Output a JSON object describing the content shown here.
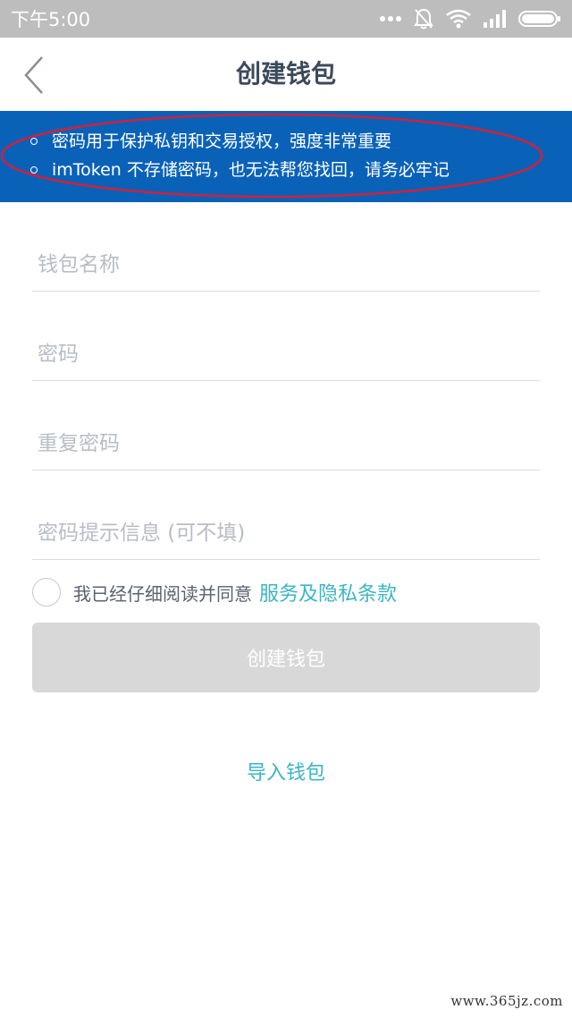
{
  "status_bar": {
    "time": "下午5:00",
    "icons": [
      "more-dots-icon",
      "bell-off-icon",
      "wifi-icon",
      "signal-icon",
      "battery-icon"
    ]
  },
  "nav": {
    "title": "创建钱包",
    "back_icon": "chevron-left-icon"
  },
  "notice": {
    "items": [
      "密码用于保护私钥和交易授权，强度非常重要",
      "imToken 不存储密码，也无法帮您找回，请务必牢记"
    ],
    "background": "#0a62b8",
    "highlight_color": "#d0213a"
  },
  "form": {
    "wallet_name_placeholder": "钱包名称",
    "password_placeholder": "密码",
    "repeat_password_placeholder": "重复密码",
    "hint_placeholder": "密码提示信息 (可不填)"
  },
  "agreement": {
    "text": "我已经仔细阅读并同意",
    "link": "服务及隐私条款",
    "checked": false
  },
  "buttons": {
    "create": "创建钱包",
    "import": "导入钱包"
  },
  "colors": {
    "accent": "#3cb5c4",
    "disabled_button": "#d8d8d8",
    "title": "#3c4a5c"
  },
  "watermark": "www.365jz.com"
}
